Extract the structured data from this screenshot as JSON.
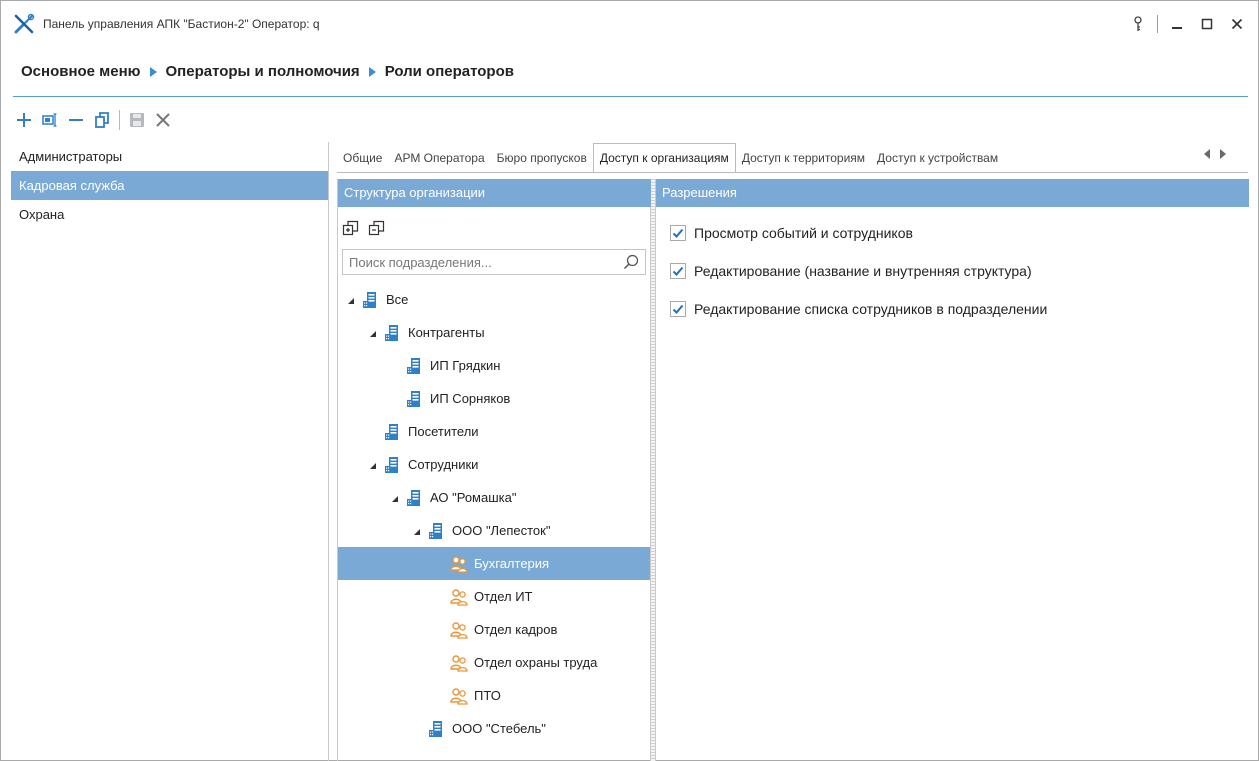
{
  "window": {
    "title": "Панель управления АПК \"Бастион-2\"  Оператор: q",
    "app_icon": "tools-icon",
    "controls": [
      {
        "name": "key-icon"
      },
      {
        "name": "minimize-icon"
      },
      {
        "name": "maximize-icon"
      },
      {
        "name": "close-icon"
      }
    ]
  },
  "breadcrumb": [
    "Основное меню",
    "Операторы и полномочия",
    "Роли операторов"
  ],
  "toolbar": {
    "buttons": [
      "add-icon",
      "rename-icon",
      "remove-icon",
      "copy-icon",
      "save-icon",
      "cancel-icon"
    ]
  },
  "roles": {
    "items": [
      "Администраторы",
      "Кадровая служба",
      "Охрана"
    ],
    "selected": "Кадровая служба"
  },
  "tabs": {
    "items": [
      "Общие",
      "АРМ Оператора",
      "Бюро пропусков",
      "Доступ к организациям",
      "Доступ к территориям",
      "Доступ к устройствам"
    ],
    "active": "Доступ к организациям"
  },
  "org_panel": {
    "header": "Структура организации",
    "search_placeholder": "Поиск подразделения...",
    "tree": [
      {
        "label": "Все",
        "level": 0,
        "expanded": true,
        "type": "building"
      },
      {
        "label": "Контрагенты",
        "level": 1,
        "expanded": true,
        "type": "building"
      },
      {
        "label": "ИП Грядкин",
        "level": 2,
        "expanded": null,
        "type": "building"
      },
      {
        "label": "ИП Сорняков",
        "level": 2,
        "expanded": null,
        "type": "building"
      },
      {
        "label": "Посетители",
        "level": 1,
        "expanded": null,
        "type": "building"
      },
      {
        "label": "Сотрудники",
        "level": 1,
        "expanded": true,
        "type": "building"
      },
      {
        "label": "АО \"Ромашка\"",
        "level": 2,
        "expanded": true,
        "type": "building"
      },
      {
        "label": "ООО \"Лепесток\"",
        "level": 3,
        "expanded": true,
        "type": "building"
      },
      {
        "label": "Бухгалтерия",
        "level": 4,
        "expanded": null,
        "type": "department",
        "selected": true
      },
      {
        "label": "Отдел ИТ",
        "level": 4,
        "expanded": null,
        "type": "department"
      },
      {
        "label": "Отдел кадров",
        "level": 4,
        "expanded": null,
        "type": "department"
      },
      {
        "label": "Отдел охраны труда",
        "level": 4,
        "expanded": null,
        "type": "department"
      },
      {
        "label": "ПТО",
        "level": 4,
        "expanded": null,
        "type": "department"
      },
      {
        "label": "ООО \"Стебель\"",
        "level": 3,
        "expanded": null,
        "type": "building"
      }
    ]
  },
  "permissions_panel": {
    "header": "Разрешения",
    "items": [
      {
        "label": "Просмотр событий и сотрудников",
        "checked": true
      },
      {
        "label": "Редактирование (название и внутренняя структура)",
        "checked": true
      },
      {
        "label": "Редактирование списка сотрудников в подразделении",
        "checked": true
      }
    ]
  },
  "colors": {
    "accent": "#7aa9d6",
    "breadcrumb_arrow": "#3c8dd0",
    "toolbar_blue": "#2f7fc9",
    "department_icon": "#e9963a"
  }
}
